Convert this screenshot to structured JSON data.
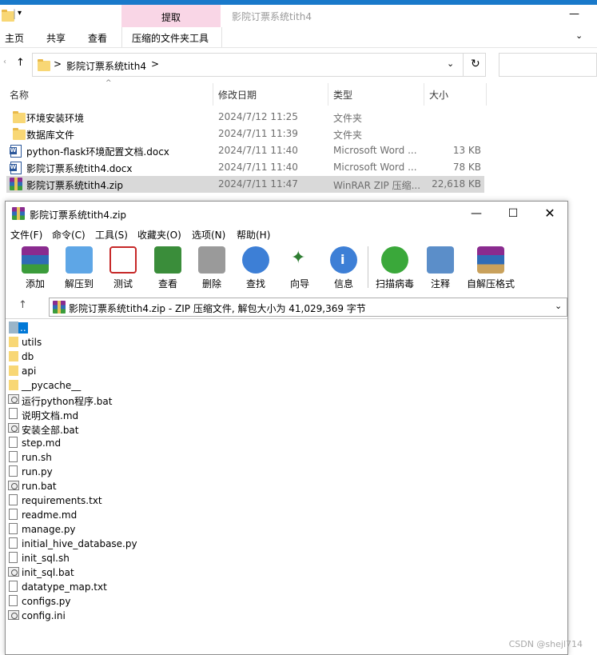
{
  "explorer": {
    "context_tab": "提取",
    "window_title": "影院订票系统tith4",
    "ribbon_tabs": [
      "主页",
      "共享",
      "查看"
    ],
    "tool_tab": "压缩的文件夹工具",
    "breadcrumb_sep": ">",
    "breadcrumb": "影院订票系统tith4",
    "columns": {
      "name": "名称",
      "date": "修改日期",
      "type": "类型",
      "size": "大小"
    },
    "files": [
      {
        "name": "环境安装环境",
        "date": "2024/7/12 11:25",
        "type": "文件夹",
        "size": "",
        "icon": "folder-icon"
      },
      {
        "name": "数据库文件",
        "date": "2024/7/11 11:39",
        "type": "文件夹",
        "size": "",
        "icon": "folder-icon"
      },
      {
        "name": "python-flask环境配置文档.docx",
        "date": "2024/7/11 11:40",
        "type": "Microsoft Word ...",
        "size": "13 KB",
        "icon": "word-icon"
      },
      {
        "name": "影院订票系统tith4.docx",
        "date": "2024/7/11 11:40",
        "type": "Microsoft Word ...",
        "size": "78 KB",
        "icon": "word-icon"
      },
      {
        "name": "影院订票系统tith4.zip",
        "date": "2024/7/11 11:47",
        "type": "WinRAR ZIP 压缩...",
        "size": "22,618 KB",
        "icon": "winrar-icon"
      }
    ]
  },
  "winrar": {
    "title": "影院订票系统tith4.zip",
    "menu": [
      "文件(F)",
      "命令(C)",
      "工具(S)",
      "收藏夹(O)",
      "选项(N)",
      "帮助(H)"
    ],
    "toolbar": [
      "添加",
      "解压到",
      "测试",
      "查看",
      "删除",
      "查找",
      "向导",
      "信息",
      "扫描病毒",
      "注释",
      "自解压格式"
    ],
    "path": "影院订票系统tith4.zip - ZIP 压缩文件, 解包大小为 41,029,369 字节",
    "items": [
      {
        "name": "..",
        "kind": "up"
      },
      {
        "name": "utils",
        "kind": "folder"
      },
      {
        "name": "db",
        "kind": "folder"
      },
      {
        "name": "api",
        "kind": "folder"
      },
      {
        "name": "__pycache__",
        "kind": "folder"
      },
      {
        "name": "运行python程序.bat",
        "kind": "bat"
      },
      {
        "name": "说明文档.md",
        "kind": "doc"
      },
      {
        "name": "安装全部.bat",
        "kind": "bat"
      },
      {
        "name": "step.md",
        "kind": "doc"
      },
      {
        "name": "run.sh",
        "kind": "doc"
      },
      {
        "name": "run.py",
        "kind": "doc"
      },
      {
        "name": "run.bat",
        "kind": "bat"
      },
      {
        "name": "requirements.txt",
        "kind": "doc"
      },
      {
        "name": "readme.md",
        "kind": "doc"
      },
      {
        "name": "manage.py",
        "kind": "doc"
      },
      {
        "name": "initial_hive_database.py",
        "kind": "doc"
      },
      {
        "name": "init_sql.sh",
        "kind": "doc"
      },
      {
        "name": "init_sql.bat",
        "kind": "bat"
      },
      {
        "name": "datatype_map.txt",
        "kind": "doc"
      },
      {
        "name": "configs.py",
        "kind": "doc"
      },
      {
        "name": "config.ini",
        "kind": "bat"
      }
    ]
  },
  "watermark": "CSDN @shejl714"
}
